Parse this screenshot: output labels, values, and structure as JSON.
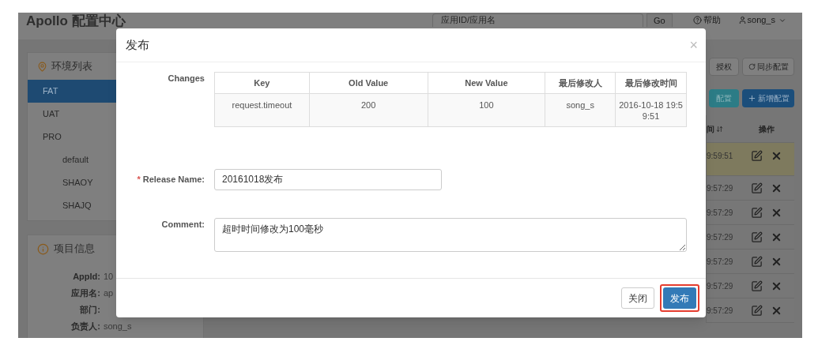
{
  "header": {
    "title": "Apollo 配置中心",
    "search": {
      "placeholder": "应用ID/应用名"
    },
    "go_button": "Go",
    "help": "帮助",
    "user": "song_s"
  },
  "env_panel": {
    "title": "环境列表",
    "items": [
      {
        "label": "FAT",
        "selected": true
      },
      {
        "label": "UAT",
        "selected": false
      },
      {
        "label": "PRO",
        "selected": false,
        "children": [
          {
            "label": "default",
            "selected": false
          },
          {
            "label": "SHAOY",
            "selected": false
          },
          {
            "label": "SHAJQ",
            "selected": false
          }
        ]
      }
    ]
  },
  "project_panel": {
    "title": "项目信息",
    "rows": [
      {
        "label": "AppId:",
        "value": "10"
      },
      {
        "label": "应用名:",
        "value": "ap"
      },
      {
        "label": "部门:"
      },
      {
        "label": "负责人:",
        "value": "song_s"
      }
    ]
  },
  "config_toolbar": {
    "buttons": [
      {
        "label": "授权",
        "kind": "plain"
      },
      {
        "label": "同步配置",
        "kind": "sync"
      },
      {
        "label": "配置",
        "kind": "teal"
      },
      {
        "label": "新增配置",
        "kind": "add"
      }
    ]
  },
  "config_table": {
    "columns": [
      "间",
      "操作"
    ],
    "rows": [
      {
        "time": "9:59:51",
        "highlighted": true
      },
      {
        "time": "9:57:29",
        "highlighted": false
      },
      {
        "time": "9:57:29",
        "highlighted": false
      },
      {
        "time": "9:57:29",
        "highlighted": false
      },
      {
        "time": "9:57:29",
        "highlighted": false
      },
      {
        "time": "9:57:29",
        "highlighted": false
      },
      {
        "time": "9:57:29",
        "highlighted": false
      }
    ]
  },
  "dialog": {
    "title": "发布",
    "close": "×",
    "changes_label": "Changes",
    "changes_table": {
      "columns": [
        "Key",
        "Old Value",
        "New Value",
        "最后修改人",
        "最后修改时间"
      ],
      "rows": [
        [
          "request.timeout",
          "200",
          "100",
          "song_s",
          "2016-10-18 19:59:51"
        ]
      ]
    },
    "release_name": {
      "label": "Release Name:",
      "required_mark": "*",
      "value": "20161018发布"
    },
    "comment": {
      "label": "Comment:",
      "value": "超时时间修改为100毫秒"
    },
    "buttons": [
      {
        "label": "关闭",
        "kind": "default",
        "highlighted": false
      },
      {
        "label": "发布",
        "kind": "primary",
        "highlighted": true
      }
    ]
  }
}
